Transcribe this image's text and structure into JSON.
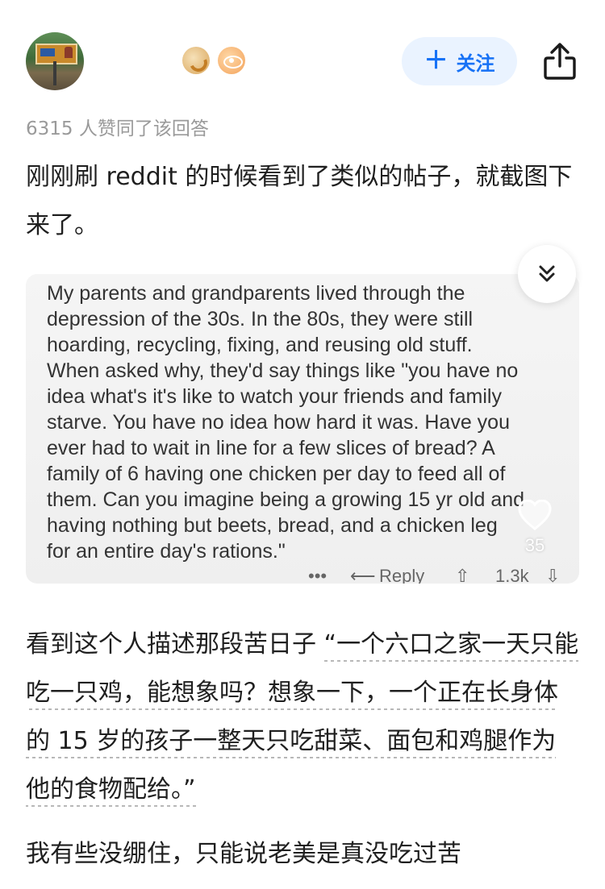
{
  "header": {
    "follow_label": "关注"
  },
  "likes_line": "6315 人赞同了该回答",
  "answer": {
    "para1": "刚刚刷 reddit 的时候看到了类似的帖子，就截图下来了。",
    "screenshot": {
      "lines": [
        "My parents and grandparents lived through the",
        "depression of the 30s. In the 80s, they were still",
        "hoarding, recycling, fixing, and reusing old stuff.",
        "When asked why, they'd say things like \"you have no",
        "idea what's it's like to watch your friends and family",
        "starve. You have no idea how hard it was. Have you",
        "ever had to wait in line for a few slices of bread? A",
        "family of 6 having one chicken per day to feed all of",
        "them. Can you imagine being a growing 15 yr old and",
        "having nothing but beets, bread, and a chicken leg",
        "for an entire day's rations.\""
      ],
      "footer": {
        "more": "•••",
        "reply": "Reply",
        "votes": "1.3k"
      }
    },
    "para2_prefix": "看到这个人描述那段苦日子",
    "para2_quote": "“一个六口之家一天只能吃一只鸡，能想象吗？想象一下，一个正在长身体的 15 岁的孩子一整天只吃甜菜、面包和鸡腿作为他的食物配给。”",
    "para3": "我有些没绷住，只能说老美是真没吃过苦"
  },
  "float": {
    "like_count": "35"
  },
  "icons": {
    "share": "share-icon",
    "collapse": "chevron-double-down-icon",
    "heart": "heart-icon",
    "plus": "plus-icon"
  },
  "colors": {
    "accent": "#1772f6",
    "accent_bg": "#eaf3ff",
    "muted_text": "#9a9a9a"
  }
}
